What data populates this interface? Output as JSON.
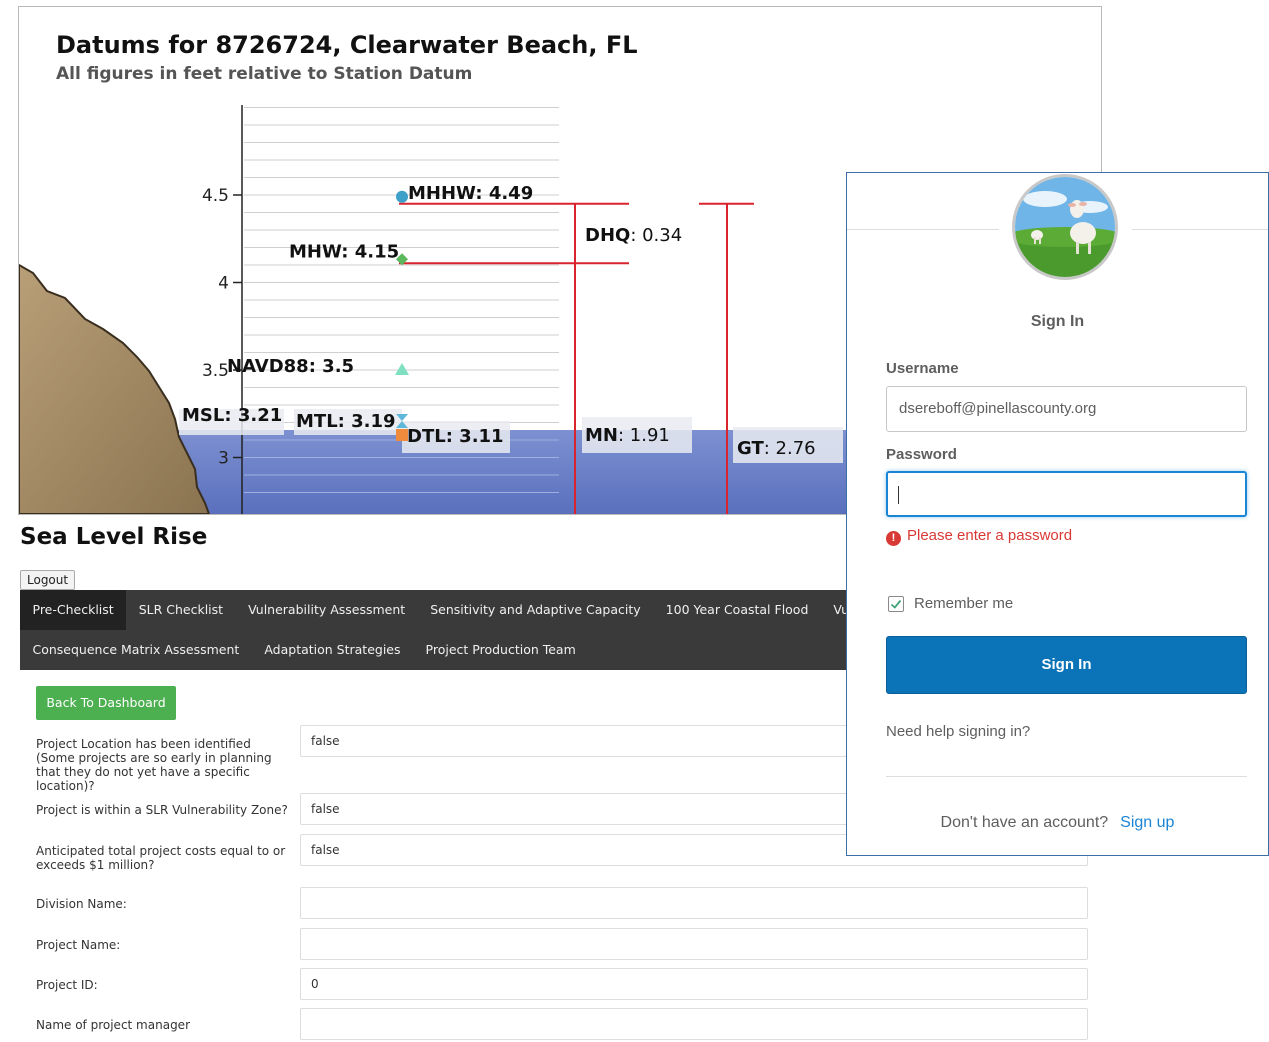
{
  "datums_panel": {
    "title": "Datums for 8726724, Clearwater Beach, FL",
    "subtitle": "All figures in feet relative to Station Datum",
    "chart_data": {
      "type": "line",
      "ylabel": "",
      "y_ticks": [
        "4.5",
        "4",
        "3.5",
        "3"
      ],
      "datums": [
        {
          "name": "MHHW",
          "value": 4.49,
          "marker": "circle",
          "color": "#3da0c8"
        },
        {
          "name": "MHW",
          "value": 4.15,
          "marker": "diamond",
          "color": "#5cb85c"
        },
        {
          "name": "NAVD88",
          "value": 3.5,
          "marker": "triangle",
          "color": "#7ee0c0"
        },
        {
          "name": "MSL",
          "value": 3.21,
          "marker": "none",
          "color": "#111111"
        },
        {
          "name": "MTL",
          "value": 3.19,
          "marker": "hourglass",
          "color": "#5fb7d9"
        },
        {
          "name": "DTL",
          "value": 3.11,
          "marker": "square",
          "color": "#f08a3c"
        }
      ],
      "ranges": [
        {
          "name": "DHQ",
          "value": 0.34
        },
        {
          "name": "MN",
          "value": 1.91
        },
        {
          "name": "GT",
          "value": 2.76
        }
      ],
      "colors": {
        "bracket": "#d9232d",
        "water": "#6c82c9",
        "land": "#a28a63"
      }
    }
  },
  "slr": {
    "title": "Sea Level Rise",
    "logout_label": "Logout",
    "nav_row1": [
      "Pre-Checklist",
      "SLR Checklist",
      "Vulnerability Assessment",
      "Sensitivity and Adaptive Capacity",
      "100 Year Coastal Flood",
      "Vulnerability Assessment"
    ],
    "nav_row2": [
      "Consequence Matrix Assessment",
      "Adaptation Strategies",
      "Project Production Team"
    ],
    "back_label": "Back To Dashboard",
    "fields": [
      {
        "label": "Project Location has been identified (Some projects are so early in planning that they do not yet have a specific location)?",
        "value": "false"
      },
      {
        "label": "Project is within a SLR Vulnerability Zone?",
        "value": "false"
      },
      {
        "label": "Anticipated total project costs equal to or exceeds $1 million?",
        "value": "false"
      },
      {
        "label": "Division Name:",
        "value": ""
      },
      {
        "label": "Project Name:",
        "value": ""
      },
      {
        "label": "Project ID:",
        "value": "0"
      },
      {
        "label": "Name of project manager",
        "value": ""
      }
    ]
  },
  "signin": {
    "heading": "Sign In",
    "username_label": "Username",
    "username_value": "dsereboff@pinellascounty.org",
    "password_label": "Password",
    "password_value": "",
    "error_text": "Please enter a password",
    "remember_label": "Remember me",
    "remember_checked": true,
    "button_label": "Sign In",
    "help_link": "Need help signing in?",
    "no_account_text": "Don't have an account?",
    "signup_link": "Sign up",
    "colors": {
      "primary": "#0b73b8",
      "error": "#d93934",
      "link": "#1a85d4"
    }
  }
}
